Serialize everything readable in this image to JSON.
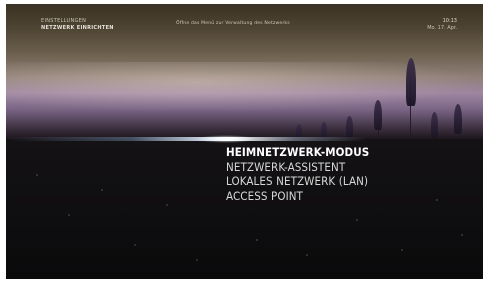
{
  "header": {
    "breadcrumb_top": "EINSTELLUNGEN",
    "breadcrumb_current": "NETZWERK EINRICHTEN",
    "hint": "Öffne das Menü zur Verwaltung des Netzwerks",
    "time": "10:13",
    "date": "Mo. 17. Apr."
  },
  "menu": {
    "items": [
      {
        "label": "HEIMNETZWERK-MODUS",
        "selected": true
      },
      {
        "label": "NETZWERK-ASSISTENT",
        "selected": false
      },
      {
        "label": "LOKALES NETZWERK (LAN)",
        "selected": false
      },
      {
        "label": "ACCESS POINT",
        "selected": false
      }
    ]
  },
  "colors": {
    "accent_flare": "#ffffff",
    "menu_text": "#d8d8d8",
    "menu_selected": "#ffffff"
  }
}
